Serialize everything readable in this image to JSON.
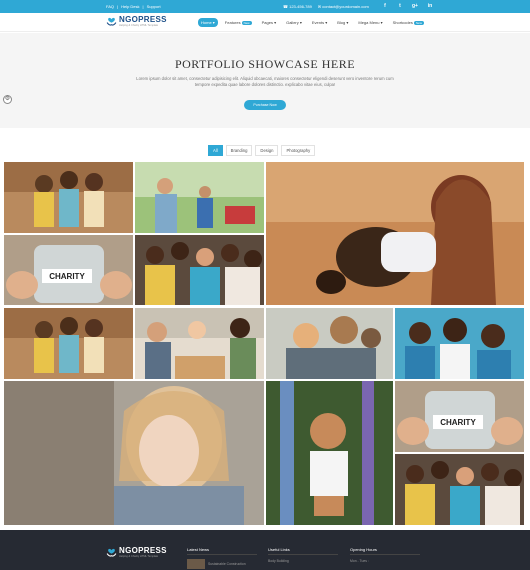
{
  "topbar": {
    "links": [
      "FAQ",
      "|",
      "Help Desk",
      "|",
      "Support"
    ],
    "phone": "123-456-789",
    "email": "contact@yourdomain.com",
    "social": [
      "f",
      "t",
      "g+",
      "in"
    ]
  },
  "header": {
    "logo_name": "NGOPRESS",
    "logo_tagline": "Helping & Charity HTML Template",
    "nav": [
      {
        "label": "Home",
        "badge": "",
        "active": true
      },
      {
        "label": "Features",
        "badge": "New",
        "active": false
      },
      {
        "label": "Pages",
        "badge": "",
        "active": false
      },
      {
        "label": "Gallery",
        "badge": "",
        "active": false
      },
      {
        "label": "Events",
        "badge": "",
        "active": false
      },
      {
        "label": "Blog",
        "badge": "",
        "active": false
      },
      {
        "label": "Mega Menu",
        "badge": "",
        "active": false
      },
      {
        "label": "Shortcodes",
        "badge": "New",
        "active": false
      }
    ]
  },
  "hero": {
    "title": "PORTFOLIO SHOWCASE HERE",
    "text": "Lorem ipsum dolor sit amet, consectetur adipisicing elit. Aliquid obcaecati, maiores consectetur eligendi deserunt vero inventore rerum cum tempore expedita quae labore dolores distinctio. explicabo vitae eius, culpa!",
    "button": "Purchase Now"
  },
  "filters": [
    {
      "label": "All",
      "active": true
    },
    {
      "label": "Branding",
      "active": false
    },
    {
      "label": "Design",
      "active": false
    },
    {
      "label": "Photography",
      "active": false
    }
  ],
  "gallery": {
    "jar_label": "CHARITY"
  },
  "footer": {
    "logo_name": "NGOPRESS",
    "logo_tagline": "Helping & Charity HTML Template",
    "latest_news": "Latest News",
    "news_item": "Sustainable Construction",
    "useful_links": "Useful Links",
    "link_item": "Body Building",
    "opening_hours": "Opening Hours",
    "hours_item": "Mon - Tues :"
  },
  "colors": {
    "accent": "#2fa8d5",
    "footer": "#262a33",
    "hero_bg": "#f5f5f5"
  }
}
